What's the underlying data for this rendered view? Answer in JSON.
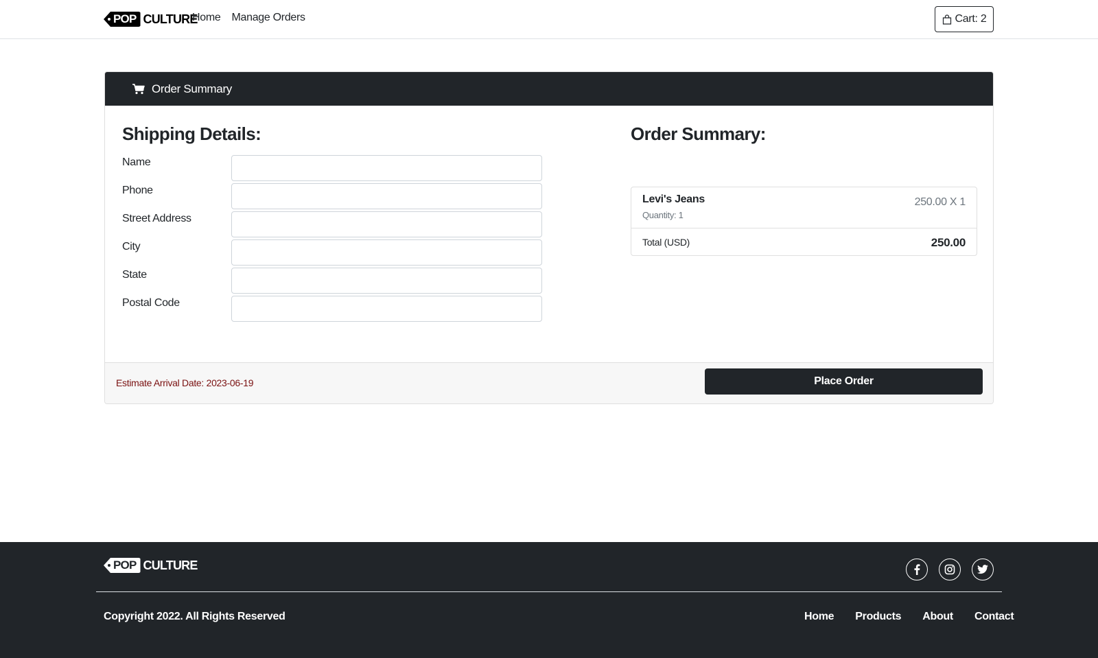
{
  "navbar": {
    "brand": {
      "tag": "POP",
      "word": "CULTURE"
    },
    "links": [
      {
        "label": "Home"
      },
      {
        "label": "Manage Orders"
      }
    ],
    "cart_label": "Cart: 2"
  },
  "card": {
    "header_title": "Order Summary",
    "shipping": {
      "title": "Shipping Details:",
      "fields": [
        {
          "label": "Name",
          "value": ""
        },
        {
          "label": "Phone",
          "value": ""
        },
        {
          "label": "Street Address",
          "value": ""
        },
        {
          "label": "City",
          "value": ""
        },
        {
          "label": "State",
          "value": ""
        },
        {
          "label": "Postal Code",
          "value": ""
        }
      ]
    },
    "summary": {
      "title": "Order Summary:",
      "items": [
        {
          "name": "Levi's Jeans",
          "quantity": "Quantity: 1",
          "price": "250.00 X 1"
        }
      ],
      "total_label": "Total (USD)",
      "total_value": "250.00"
    },
    "footer": {
      "arrival": "Estimate Arrival Date: 2023-06-19",
      "place_order_label": "Place Order"
    }
  },
  "footer": {
    "brand": {
      "tag": "POP",
      "word": "CULTURE"
    },
    "socials": [
      {
        "icon": "facebook-icon"
      },
      {
        "icon": "instagram-icon"
      },
      {
        "icon": "twitter-icon"
      }
    ],
    "copyright": "Copyright 2022. All Rights Reserved",
    "links": [
      {
        "label": "Home"
      },
      {
        "label": "Products"
      },
      {
        "label": "About"
      },
      {
        "label": "Contact"
      }
    ]
  },
  "colors": {
    "dark": "#212529",
    "arrival_text": "#7a1111",
    "muted": "#6c757d",
    "border": "#dfdfdf"
  }
}
